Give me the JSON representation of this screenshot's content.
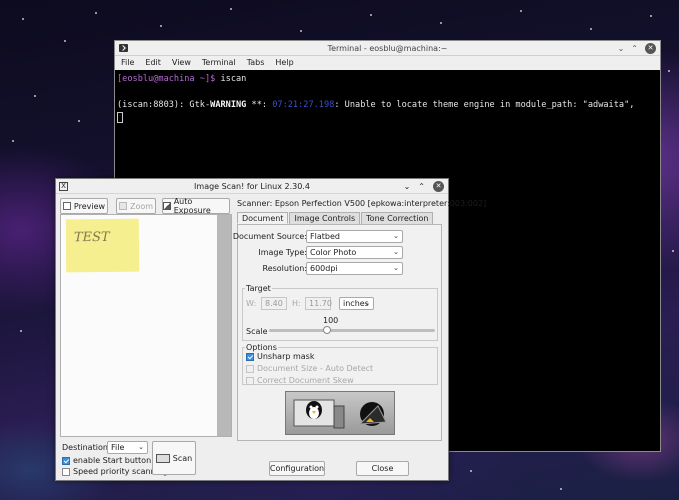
{
  "terminal": {
    "title": "Terminal - eosblu@machina:~",
    "menu": [
      "File",
      "Edit",
      "View",
      "Terminal",
      "Tabs",
      "Help"
    ],
    "prompt": "[eosblu@machina ~]$",
    "command": " iscan",
    "warning_prefix": "(iscan:8803): Gtk-",
    "warning_word": "WARNING",
    "warning_stars": " **: ",
    "warning_time": "07:21:27.198",
    "warning_message": ": Unable to locate theme engine in module_path: \"adwaita\","
  },
  "scan": {
    "title": "Image Scan! for Linux 2.30.4",
    "toolbar": {
      "preview": "Preview",
      "zoom": "Zoom",
      "auto_exposure": "Auto Exposure"
    },
    "preview_note": "TEST",
    "scanner_line": "Scanner:  Epson Perfection V500 [epkowa:interpreter:003:002]",
    "tabs": [
      "Document",
      "Image Controls",
      "Tone Correction"
    ],
    "document_source": {
      "label": "Document Source:",
      "value": "Flatbed"
    },
    "image_type": {
      "label": "Image Type:",
      "value": "Color Photo"
    },
    "resolution": {
      "label": "Resolution:",
      "value": "600dpi"
    },
    "target": {
      "title": "Target",
      "w_label": "W:",
      "w_value": "8.40",
      "h_label": "H:",
      "h_value": "11.70",
      "units": "inches",
      "scale_label": "Scale",
      "scale_value": "100"
    },
    "options": {
      "title": "Options",
      "unsharp_mask": "Unsharp mask",
      "doc_size": "Document Size - Auto Detect",
      "doc_skew": "Correct Document Skew"
    },
    "destination": {
      "label": "Destination:",
      "value": "File"
    },
    "enable_start": "enable Start button",
    "speed_priority": "Speed priority scanning",
    "scan_button": "Scan",
    "configuration_button": "Configuration",
    "close_button": "Close"
  }
}
